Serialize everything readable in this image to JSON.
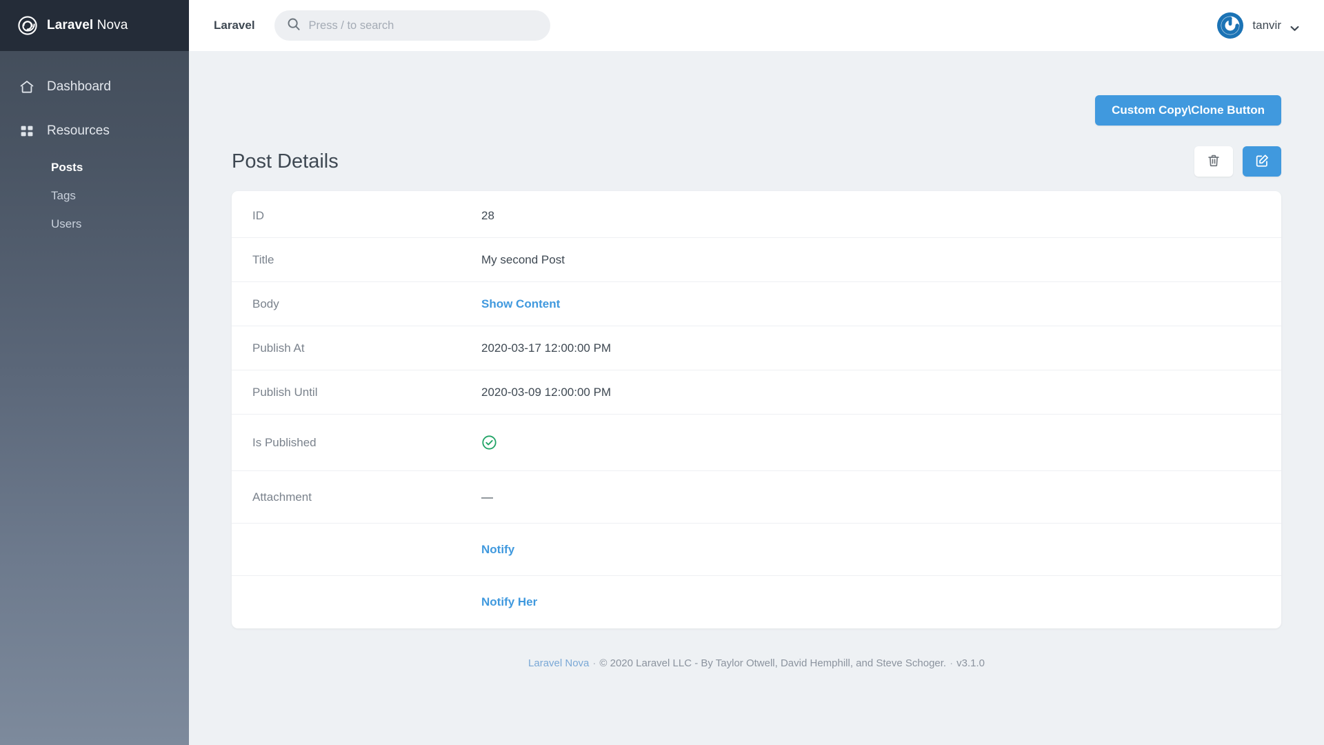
{
  "sidebar": {
    "logo": {
      "icon": "nova-spiral-logo-icon",
      "bold": "Laravel",
      "light": " Nova"
    },
    "items": [
      {
        "label": "Dashboard",
        "icon": "home-icon"
      },
      {
        "label": "Resources",
        "icon": "grid-icon"
      }
    ],
    "sub_items": [
      {
        "label": "Posts",
        "active": true
      },
      {
        "label": "Tags",
        "active": false
      },
      {
        "label": "Users",
        "active": false
      }
    ]
  },
  "topbar": {
    "brand": "Laravel",
    "search": {
      "placeholder": "Press / to search",
      "value": "",
      "icon": "search-icon"
    },
    "user": {
      "name": "tanvir",
      "avatar_icon": "gravatar-power-icon",
      "chevron_icon": "chevron-down-icon"
    }
  },
  "main": {
    "custom_button": "Custom Copy\\Clone Button",
    "panel_title": "Post Details",
    "actions": [
      {
        "name": "delete",
        "icon": "trash-icon",
        "style": "light"
      },
      {
        "name": "edit",
        "icon": "edit-pencil-square-icon",
        "style": "blue"
      }
    ],
    "fields": [
      {
        "label": "ID",
        "value": "28",
        "type": "text"
      },
      {
        "label": "Title",
        "value": "My second Post",
        "type": "text"
      },
      {
        "label": "Body",
        "value": "Show Content",
        "type": "link"
      },
      {
        "label": "Publish At",
        "value": "2020-03-17 12:00:00 PM",
        "type": "text"
      },
      {
        "label": "Publish Until",
        "value": "2020-03-09 12:00:00 PM",
        "type": "text"
      },
      {
        "label": "Is Published",
        "value": "",
        "type": "boolean-true",
        "icon": "check-circle-icon"
      },
      {
        "label": "Attachment",
        "value": "—",
        "type": "dash"
      },
      {
        "label": "",
        "value": "Notify",
        "type": "link"
      },
      {
        "label": "",
        "value": "Notify Her",
        "type": "link"
      }
    ]
  },
  "footer": {
    "link": "Laravel Nova",
    "sep1": "·",
    "copyright": "© 2020 Laravel LLC - By Taylor Otwell, David Hemphill, and Steve Schoger.",
    "sep2": "·",
    "version": "v3.1.0"
  },
  "colors": {
    "accent_blue": "#4099de",
    "link_blue": "#4099de",
    "success_green": "#21a366",
    "sidebar_top": "#414b58",
    "sidebar_bottom": "#7d8a9c",
    "logo_bg": "#242c38",
    "page_bg": "#eef1f4",
    "text_dark": "#3e4852",
    "text_muted": "#7a828c"
  }
}
